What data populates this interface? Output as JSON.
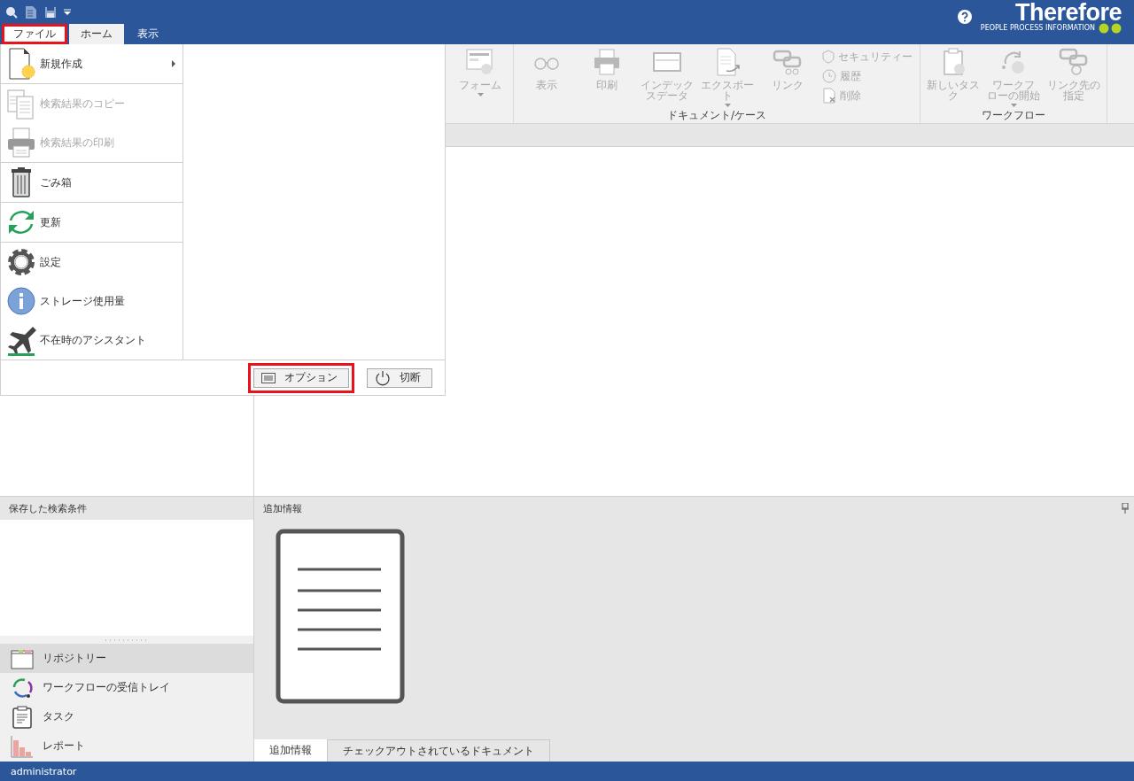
{
  "quick_access": [
    {
      "kind": "search"
    },
    {
      "kind": "document"
    },
    {
      "kind": "save"
    },
    {
      "kind": "dropdown"
    }
  ],
  "logo": {
    "name": "Therefore",
    "tagline": "PEOPLE  PROCESS  INFORMATION"
  },
  "ribbon_tabs": [
    {
      "label": "ファイル",
      "selected": true,
      "current": false,
      "highlighted": true
    },
    {
      "label": "ホーム",
      "selected": false,
      "current": true,
      "highlighted": false
    },
    {
      "label": "表示",
      "selected": false,
      "current": false,
      "highlighted": false
    }
  ],
  "ribbon_groups": [
    {
      "items": [
        {
          "kind": "form",
          "lines": [
            "フォーム"
          ],
          "disabled": true,
          "dropdown": true
        }
      ]
    },
    {
      "label": "ドキュメント/ケース",
      "items": [
        {
          "kind": "view",
          "lines": [
            "表示"
          ],
          "disabled": true,
          "dropdown": false
        },
        {
          "kind": "print",
          "lines": [
            "印刷"
          ],
          "disabled": true,
          "dropdown": false
        },
        {
          "kind": "index",
          "lines": [
            "インデック",
            "スデータ"
          ],
          "disabled": true,
          "dropdown": false
        },
        {
          "kind": "export",
          "lines": [
            "エクスポー",
            "ト"
          ],
          "disabled": true,
          "dropdown": true
        },
        {
          "kind": "link",
          "lines": [
            "リンク"
          ],
          "disabled": true,
          "dropdown": false
        }
      ],
      "small_items": [
        {
          "kind": "security",
          "label": "セキュリティー",
          "disabled": true
        },
        {
          "kind": "history",
          "label": "履歴",
          "disabled": true
        },
        {
          "kind": "delete",
          "label": "削除",
          "disabled": true
        }
      ]
    },
    {
      "label": "ワークフロー",
      "items": [
        {
          "kind": "task",
          "lines": [
            "新しいタス",
            "ク"
          ],
          "disabled": true,
          "dropdown": false
        },
        {
          "kind": "workflow",
          "lines": [
            "ワークフ",
            "ローの開始"
          ],
          "disabled": true,
          "dropdown": true
        },
        {
          "kind": "linkto",
          "lines": [
            "リンク先の",
            "指定"
          ],
          "disabled": true,
          "dropdown": false
        }
      ]
    }
  ],
  "file_menu": {
    "groups": [
      [
        {
          "kind": "new",
          "label": "新規作成",
          "disabled": false,
          "submenu": true
        }
      ],
      [
        {
          "kind": "copy",
          "label": "検索結果のコピー",
          "disabled": true,
          "submenu": false
        },
        {
          "kind": "print",
          "label": "検索結果の印刷",
          "disabled": true,
          "submenu": false
        }
      ],
      [
        {
          "kind": "trash",
          "label": "ごみ箱",
          "disabled": false,
          "submenu": false
        }
      ],
      [
        {
          "kind": "refresh",
          "label": "更新",
          "disabled": false,
          "submenu": false
        }
      ],
      [
        {
          "kind": "settings",
          "label": "設定",
          "disabled": false,
          "submenu": false
        },
        {
          "kind": "info",
          "label": "ストレージ使用量",
          "disabled": false,
          "submenu": false
        },
        {
          "kind": "plane",
          "label": "不在時のアシスタント",
          "disabled": false,
          "submenu": false
        }
      ]
    ],
    "buttons": [
      {
        "kind": "options",
        "label": "オプション",
        "highlighted": true
      },
      {
        "kind": "power",
        "label": "切断",
        "highlighted": false
      }
    ]
  },
  "saved_searches": {
    "title": "保存した検索条件"
  },
  "navigation": [
    {
      "kind": "repository",
      "label": "リポジトリー",
      "selected": true
    },
    {
      "kind": "inbox",
      "label": "ワークフローの受信トレイ",
      "selected": false
    },
    {
      "kind": "task",
      "label": "タスク",
      "selected": false
    },
    {
      "kind": "report",
      "label": "レポート",
      "selected": false
    }
  ],
  "info_panel": {
    "title": "追加情報",
    "tabs": [
      {
        "label": "追加情報",
        "selected": true
      },
      {
        "label": "チェックアウトされているドキュメント",
        "selected": false
      }
    ]
  },
  "status_bar": {
    "user": "administrator"
  }
}
